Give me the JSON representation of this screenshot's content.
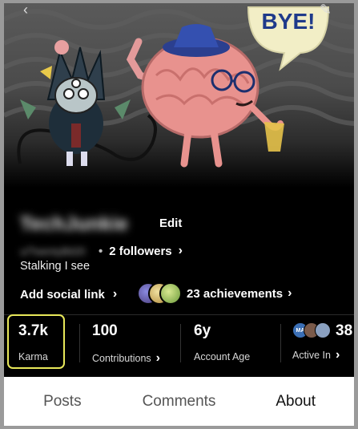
{
  "banner": {
    "speech_text": "BYE!"
  },
  "profile": {
    "display_name": "TechJunkie",
    "edit_label": "Edit",
    "username": "u/TwentyBit20",
    "followers_label": "2 followers",
    "bio": "Stalking I see",
    "social_link_label": "Add social link",
    "achievements_label": "23 achievements"
  },
  "stats": {
    "karma": {
      "value": "3.7k",
      "label": "Karma"
    },
    "contributions": {
      "value": "100",
      "label": "Contributions"
    },
    "account_age": {
      "value": "6y",
      "label": "Account Age"
    },
    "active_in": {
      "value": "38",
      "label": "Active In",
      "first_avatar_text": "MA"
    }
  },
  "tabs": [
    {
      "label": "Posts",
      "active": false
    },
    {
      "label": "Comments",
      "active": false
    },
    {
      "label": "About",
      "active": true
    }
  ],
  "colors": {
    "highlight": "#e8e85a",
    "tab_bar_bg": "#ffffff",
    "background": "#000000"
  }
}
